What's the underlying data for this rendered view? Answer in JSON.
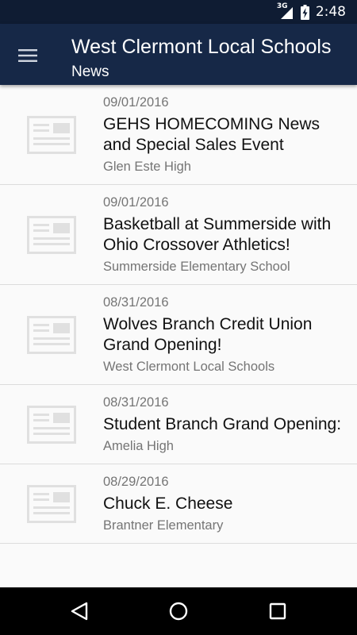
{
  "status_bar": {
    "network_label": "3G",
    "time": "2:48"
  },
  "app_bar": {
    "title": "West Clermont Local Schools",
    "subtitle": "News"
  },
  "news": [
    {
      "date": "09/01/2016",
      "title": "GEHS HOMECOMING News and Special Sales Event",
      "source": "Glen Este High"
    },
    {
      "date": "09/01/2016",
      "title": "Basketball at Summerside with Ohio Crossover Athletics!",
      "source": "Summerside Elementary School"
    },
    {
      "date": "08/31/2016",
      "title": "Wolves Branch Credit Union Grand Opening!",
      "source": "West Clermont Local Schools"
    },
    {
      "date": "08/31/2016",
      "title": "Student Branch Grand Opening:",
      "source": "Amelia High"
    },
    {
      "date": "08/29/2016",
      "title": "Chuck E. Cheese",
      "source": "Brantner Elementary"
    }
  ],
  "colors": {
    "status_bar": "#0f1c33",
    "app_bar": "#162847",
    "list_background": "#fafafa",
    "meta_text": "#757575"
  },
  "icons": {
    "menu": "hamburger-menu-icon",
    "thumbnail": "newspaper-icon",
    "back": "back-triangle-icon",
    "home": "home-circle-icon",
    "recents": "recents-square-icon"
  }
}
